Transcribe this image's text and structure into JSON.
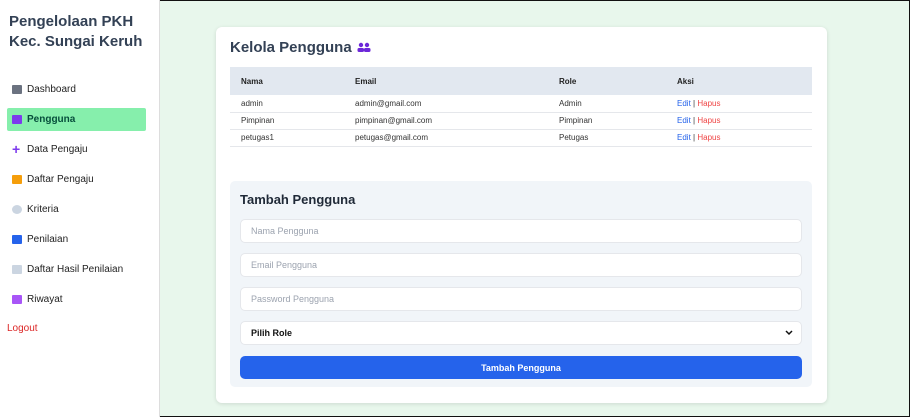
{
  "sidebar": {
    "brand": "Pengelolaan PKH Kec. Sungai Keruh",
    "items": [
      {
        "label": "Dashboard",
        "icon": "bank-icon",
        "color": "#6b7280"
      },
      {
        "label": "Pengguna",
        "icon": "people-icon",
        "color": "#7c3aed",
        "active": true
      },
      {
        "label": "Data Pengaju",
        "icon": "plus-icon",
        "color": "#7c3aed"
      },
      {
        "label": "Daftar Pengaju",
        "icon": "folder-icon",
        "color": "#f59e0b"
      },
      {
        "label": "Kriteria",
        "icon": "gear-icon",
        "color": "#94a3b8"
      },
      {
        "label": "Penilaian",
        "icon": "bar-chart-icon",
        "color": "#2563eb"
      },
      {
        "label": "Daftar Hasil Penilaian",
        "icon": "document-icon",
        "color": "#cbd5e1"
      },
      {
        "label": "Riwayat",
        "icon": "scroll-icon",
        "color": "#a855f7"
      }
    ],
    "logout": "Logout"
  },
  "main": {
    "title": "Kelola Pengguna",
    "title_icon": "people-icon",
    "table": {
      "headers": [
        "Nama",
        "Email",
        "Role",
        "Aksi"
      ],
      "rows": [
        {
          "nama": "admin",
          "email": "admin@gmail.com",
          "role": "Admin"
        },
        {
          "nama": "Pimpinan",
          "email": "pimpinan@gmail.com",
          "role": "Pimpinan"
        },
        {
          "nama": "petugas1",
          "email": "petugas@gmail.com",
          "role": "Petugas"
        }
      ],
      "edit_label": "Edit",
      "separator": "|",
      "delete_label": "Hapus"
    }
  },
  "form": {
    "title": "Tambah Pengguna",
    "name_placeholder": "Nama Pengguna",
    "email_placeholder": "Email Pengguna",
    "password_placeholder": "Password Pengguna",
    "role_selected": "Pilih Role",
    "submit_label": "Tambah Pengguna"
  }
}
